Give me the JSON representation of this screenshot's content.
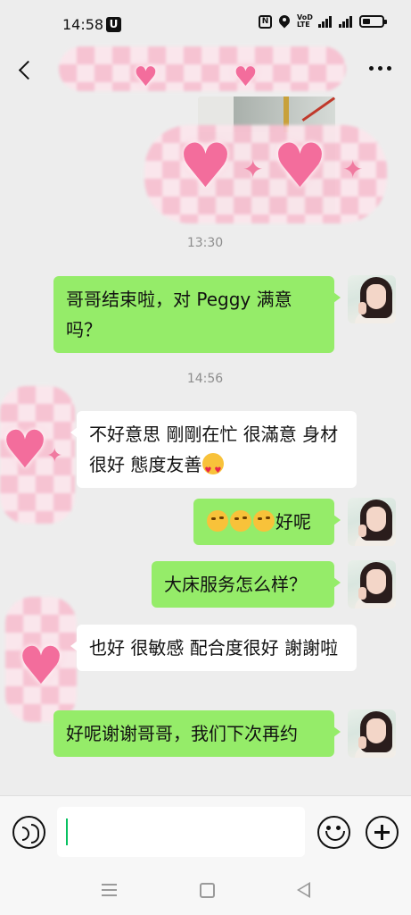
{
  "status_bar": {
    "time": "14:58",
    "app_badge": "U",
    "nfc_label": "N",
    "volte_label": "VoD LTE",
    "battery_level": 0.3
  },
  "title_bar": {
    "title": ""
  },
  "messages": [
    {
      "type": "timestamp",
      "text": "13:30"
    },
    {
      "type": "outgoing",
      "text": "哥哥结束啦，对 Peggy 满意吗？"
    },
    {
      "type": "timestamp",
      "text": "14:56"
    },
    {
      "type": "incoming",
      "text": "不好意思 剛剛在忙 很滿意 身材很好 態度友善",
      "trailing_emoji": "smiling-face-with-heart-eyes"
    },
    {
      "type": "outgoing",
      "text": "好呢",
      "leading_emojis": [
        "face-with-monocle",
        "face-with-monocle",
        "face-with-monocle"
      ]
    },
    {
      "type": "outgoing",
      "text": "大床服务怎么样？"
    },
    {
      "type": "incoming",
      "text": "也好 很敏感 配合度很好 謝謝啦"
    },
    {
      "type": "outgoing",
      "text": "好呢谢谢哥哥，我们下次再约"
    }
  ],
  "input_bar": {
    "value": "",
    "accent_color": "#07c160"
  },
  "colors": {
    "outgoing_bubble": "#95ec69",
    "incoming_bubble": "#ffffff",
    "background": "#ededed"
  }
}
